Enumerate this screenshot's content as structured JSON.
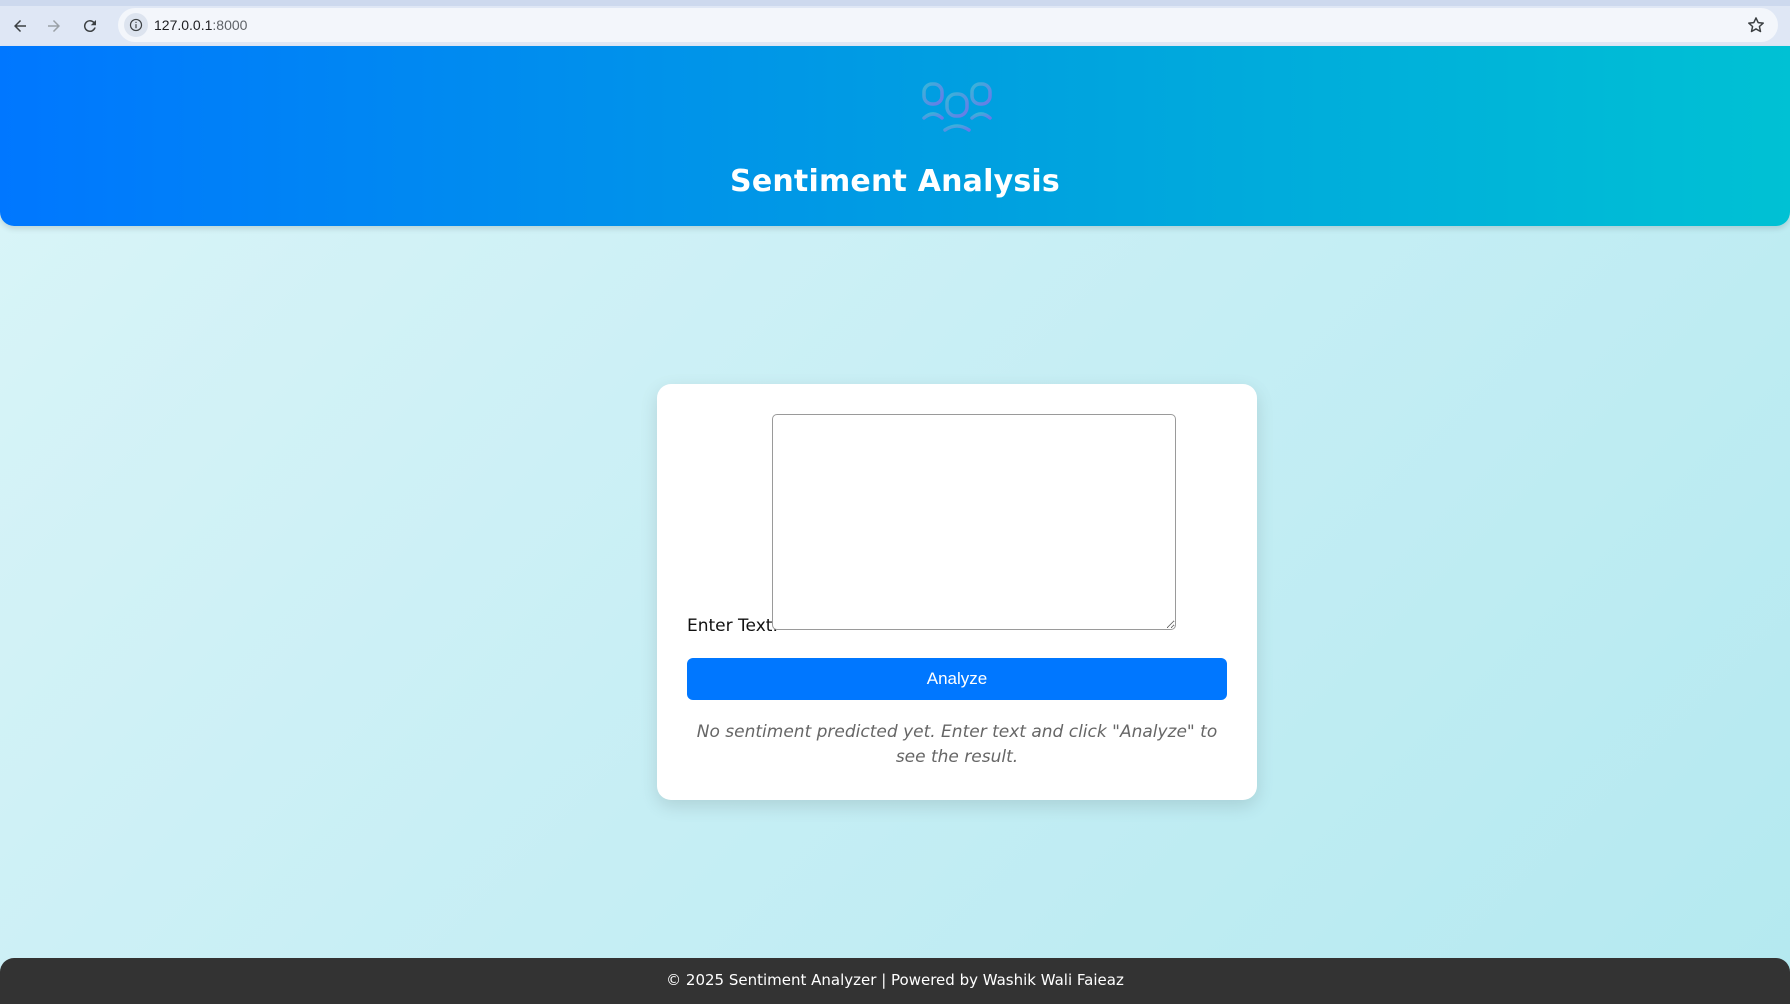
{
  "browser": {
    "url_host": "127.0.0.1",
    "url_port": ":8000",
    "back_icon": "arrow-left-icon",
    "forward_icon": "arrow-right-icon",
    "reload_icon": "reload-icon",
    "info_icon": "info-icon",
    "bookmark_icon": "star-icon"
  },
  "header": {
    "logo_icon": "robot-faces-icon",
    "title": "Sentiment Analysis",
    "gradient_start": "#0077ff",
    "gradient_end": "#00c1d4"
  },
  "form": {
    "label": "Enter Text:",
    "input_value": "",
    "button_label": "Analyze",
    "button_color": "#0077ff",
    "result_message": "No sentiment predicted yet. Enter text and click \"Analyze\" to see the result."
  },
  "footer": {
    "text": "© 2025 Sentiment Analyzer | Powered by Washik Wali Faieaz"
  }
}
